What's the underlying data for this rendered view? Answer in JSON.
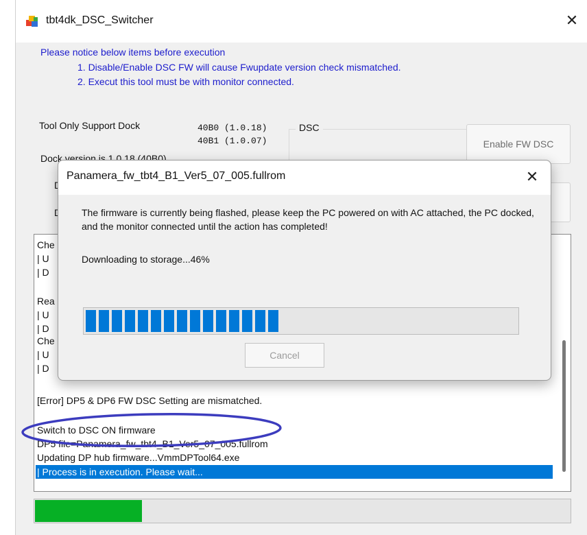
{
  "window": {
    "title": "tbt4dk_DSC_Switcher",
    "close_glyph": "✕",
    "app_icon": "colored-cube-icon"
  },
  "notice": {
    "heading": "Please notice below items before execution",
    "items": [
      "1. Disable/Enable DSC FW will cause Fwupdate version check mismatched.",
      "2. Execut this tool must be with monitor connected."
    ]
  },
  "dock_support": {
    "label": "Tool Only Support Dock",
    "versions": [
      "40B0 (1.0.18)",
      "40B1 (1.0.07)"
    ],
    "dock_version_text": "Dock version is 1.0.18 (40B0)",
    "row_stubs": [
      "D",
      "D"
    ]
  },
  "dsc_group": {
    "legend": "DSC",
    "enable_button": "Enable FW DSC"
  },
  "log": {
    "lines": [
      "Che",
      "|   U",
      "|   D",
      "Rea",
      "|   U",
      "|   D",
      "Che",
      "|   U",
      "|   D",
      "[Error] DP5 & DP6 FW DSC Setting are mismatched.",
      "Switch to DSC ON firmware",
      "DP5 file=Panamera_fw_tbt4_B1_Ver5_07_005.fullrom",
      "Updating DP hub firmware...VmmDPTool64.exe",
      "|    Process is in execution. Please wait..."
    ],
    "selected_index": 13,
    "annotation_color": "#3c3cbe"
  },
  "bottom_progress": {
    "fraction": 0.2,
    "color": "#06b025"
  },
  "dialog": {
    "title": "Panamera_fw_tbt4_B1_Ver5_07_005.fullrom",
    "close_glyph": "✕",
    "message": "The firmware is currently being flashed, please keep the PC powered on with AC attached, the PC docked, and the monitor connected until the action has completed!",
    "status": "Downloading to storage...46%",
    "progress_percent": 46,
    "progress_color": "#0078d7",
    "cancel_label": "Cancel"
  }
}
